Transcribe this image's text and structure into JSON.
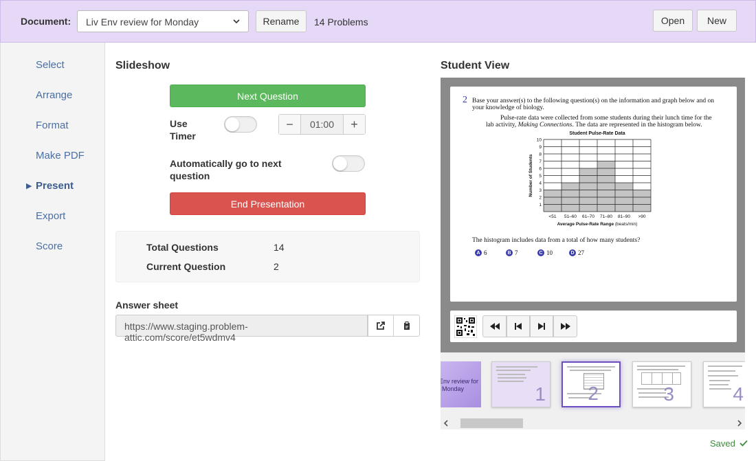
{
  "header": {
    "document_label": "Document:",
    "document_selected": "Liv Env review for Monday",
    "rename_label": "Rename",
    "problems_count": "14 Problems",
    "open_label": "Open",
    "new_label": "New"
  },
  "sidebar": {
    "items": [
      {
        "label": "Select"
      },
      {
        "label": "Arrange"
      },
      {
        "label": "Format"
      },
      {
        "label": "Make PDF"
      },
      {
        "label": "Present"
      },
      {
        "label": "Export"
      },
      {
        "label": "Score"
      }
    ],
    "active": "Present"
  },
  "slideshow": {
    "title": "Slideshow",
    "next_label": "Next Question",
    "use_timer_line1": "Use",
    "use_timer_line2": "Timer",
    "timer_value": "01:00",
    "timer_minus": "−",
    "timer_plus": "+",
    "auto_next_line1": "Automatically go to next",
    "auto_next_line2": "question",
    "end_label": "End Presentation",
    "total_label": "Total Questions",
    "total_value": "14",
    "current_label": "Current Question",
    "current_value": "2",
    "answer_sheet_label": "Answer sheet",
    "answer_sheet_url": "https://www.staging.problem-attic.com/score/et5wdmv4"
  },
  "student_view": {
    "title": "Student View",
    "question_number": "2",
    "intro_line1": "Base your answer(s) to the following question(s) on the information and graph below and on",
    "intro_line2": "your knowledge of biology.",
    "body_line1": "Pulse-rate data were collected from some students during their lunch time for the",
    "body_line2_a": "lab activity, ",
    "body_line2_b": "Making Connections",
    "body_line2_c": ".  The data are represented in the histogram below.",
    "question_text": "The histogram includes data from a total of how many students?",
    "choices": [
      {
        "letter": "A",
        "text": "6"
      },
      {
        "letter": "B",
        "text": "7"
      },
      {
        "letter": "C",
        "text": "10"
      },
      {
        "letter": "D",
        "text": "27"
      }
    ]
  },
  "chart_data": {
    "type": "bar",
    "title": "Student Pulse-Rate Data",
    "xlabel": "Average Pulse-Rate Range",
    "xlabel_unit": "(beats/min)",
    "ylabel": "Number of Students",
    "categories": [
      "<51",
      "51–60",
      "61–70",
      "71–80",
      "81–90",
      ">90"
    ],
    "values": [
      3,
      4,
      6,
      7,
      4,
      3
    ],
    "yticks": [
      "1",
      "2",
      "3",
      "4",
      "5",
      "6",
      "7",
      "8",
      "9",
      "10"
    ],
    "ylim": [
      0,
      10
    ],
    "grid": true
  },
  "thumbnails": {
    "title_slide_text_1": "Env review for",
    "title_slide_text_2": "Monday",
    "slides": [
      "1",
      "2",
      "3",
      "4"
    ],
    "current": "2"
  },
  "status": {
    "saved_label": "Saved"
  },
  "colors": {
    "header_bg": "#e6d9f8",
    "accent_purple": "#9b8dc4",
    "green": "#5cb85c",
    "red": "#d9534f",
    "link_blue": "#4a6fa5"
  }
}
